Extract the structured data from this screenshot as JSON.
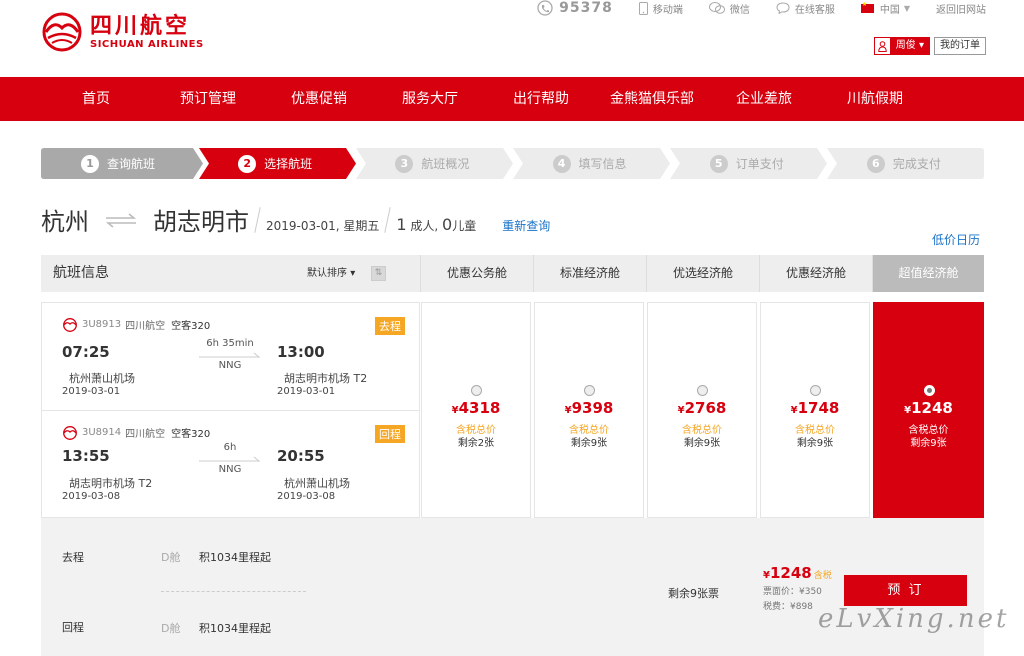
{
  "brand": {
    "name_cn": "四川航空",
    "name_en": "SICHUAN AIRLINES",
    "color": "#d7000f"
  },
  "utility": {
    "phone": "95378",
    "mobile": "移动端",
    "wechat": "微信",
    "service": "在线客服",
    "region": "中国",
    "old_site": "返回旧网站"
  },
  "user": {
    "name": "周俊",
    "orders": "我的订单"
  },
  "nav": [
    "首页",
    "预订管理",
    "优惠促销",
    "服务大厅",
    "出行帮助",
    "金熊猫俱乐部",
    "企业差旅",
    "川航假期"
  ],
  "steps": [
    {
      "num": "1",
      "label": "查询航班",
      "state": "done"
    },
    {
      "num": "2",
      "label": "选择航班",
      "state": "active"
    },
    {
      "num": "3",
      "label": "航班概况",
      "state": "todo"
    },
    {
      "num": "4",
      "label": "填写信息",
      "state": "todo"
    },
    {
      "num": "5",
      "label": "订单支付",
      "state": "todo"
    },
    {
      "num": "6",
      "label": "完成支付",
      "state": "todo"
    }
  ],
  "route": {
    "from": "杭州",
    "to": "胡志明市",
    "date": "2019-03-01, 星期五",
    "adult_count": "1",
    "adult_label": "成人,",
    "child_count": "0",
    "child_label": "儿童",
    "requery": "重新查询"
  },
  "low_price_calendar": "低价日历",
  "table_head": {
    "info": "航班信息",
    "sort": "默认排序",
    "cabins": [
      "优惠公务舱",
      "标准经济舱",
      "优选经济舱",
      "优惠经济舱",
      "超值经济舱"
    ]
  },
  "segments": [
    {
      "flight_no": "3U8913",
      "airline": "四川航空",
      "aircraft": "空客320",
      "tag": "去程",
      "dep_time": "07:25",
      "dep_airport": "杭州萧山机场",
      "dep_date": "2019-03-01",
      "duration": "6h 35min",
      "stop": "NNG",
      "arr_time": "13:00",
      "arr_airport": "胡志明市机场  T2",
      "arr_date": "2019-03-01"
    },
    {
      "flight_no": "3U8914",
      "airline": "四川航空",
      "aircraft": "空客320",
      "tag": "回程",
      "dep_time": "13:55",
      "dep_airport": "胡志明市机场  T2",
      "dep_date": "2019-03-08",
      "duration": "6h",
      "stop": "NNG",
      "arr_time": "20:55",
      "arr_airport": "杭州萧山机场",
      "arr_date": "2019-03-08"
    }
  ],
  "fares": [
    {
      "currency": "¥",
      "price": "4318",
      "tax_label": "含税总价",
      "remain": "剩余2张",
      "selected": false
    },
    {
      "currency": "¥",
      "price": "9398",
      "tax_label": "含税总价",
      "remain": "剩余9张",
      "selected": false
    },
    {
      "currency": "¥",
      "price": "2768",
      "tax_label": "含税总价",
      "remain": "剩余9张",
      "selected": false
    },
    {
      "currency": "¥",
      "price": "1748",
      "tax_label": "含税总价",
      "remain": "剩余9张",
      "selected": false
    },
    {
      "currency": "¥",
      "price": "1248",
      "tax_label": "含税总价",
      "remain": "剩余9张",
      "selected": true
    }
  ],
  "detail": {
    "outbound_label": "去程",
    "outbound_cabin": "D舱",
    "outbound_miles": "积1034里程起",
    "return_label": "回程",
    "return_cabin": "D舱",
    "return_miles": "积1034里程起",
    "tickets_left": "剩余9张票",
    "total_currency": "¥",
    "total": "1248",
    "total_label": "含税",
    "fare_face": "票面价：¥350",
    "fare_tax": "税费：¥898",
    "book": "预 订"
  },
  "watermark": "eLvXing.net"
}
